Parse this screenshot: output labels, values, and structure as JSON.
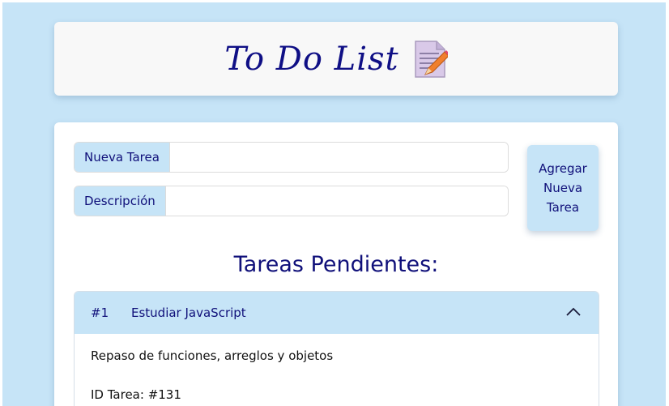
{
  "header": {
    "title": "To Do List",
    "icon": "memo-icon"
  },
  "form": {
    "task_label": "Nueva Tarea",
    "task_value": "",
    "desc_label": "Descripción",
    "desc_value": "",
    "add_button": "Agregar Nueva Tarea"
  },
  "section_title": "Tareas Pendientes:",
  "tasks": [
    {
      "number": "#1",
      "title": "Estudiar JavaScript",
      "description": "Repaso de funciones, arreglos y objetos",
      "id_text": "ID Tarea: #131",
      "expanded": true
    }
  ],
  "colors": {
    "background": "#c6e4f7",
    "accent_text": "#10107a",
    "card": "#ffffff"
  }
}
